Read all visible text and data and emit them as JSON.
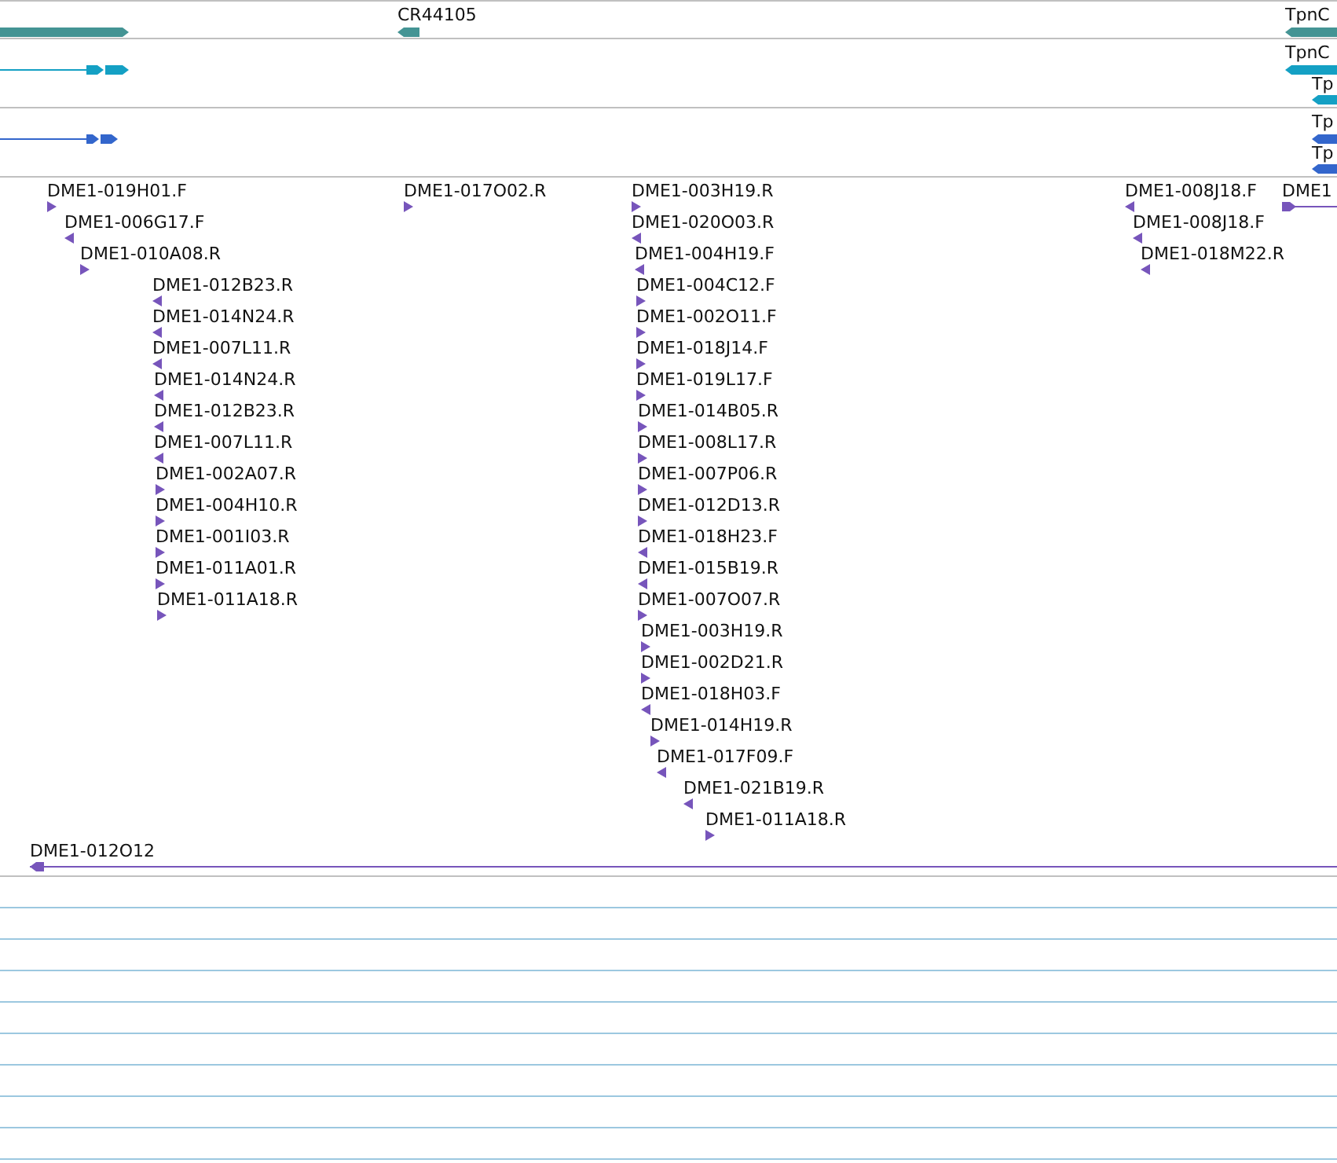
{
  "tracks": [
    {
      "kind": "genes",
      "features": [
        {
          "reverse": false
        },
        {
          "label": "CR44105",
          "reverse": true
        },
        {
          "label": "TpnC",
          "reverse": true
        }
      ]
    },
    {
      "kind": "transcripts",
      "features": [
        {
          "reverse": false
        },
        {
          "label": "TpnC",
          "reverse": true
        },
        {
          "label": "Tp",
          "reverse": true
        }
      ]
    },
    {
      "kind": "proteins",
      "features": [
        {
          "reverse": false
        },
        {
          "label": "Tp",
          "reverse": true
        },
        {
          "label": "Tp",
          "reverse": true
        }
      ]
    },
    {
      "kind": "reads",
      "features": [
        {
          "label": "DME1-019H01.F",
          "reverse": false
        },
        {
          "label": "DME1-006G17.F",
          "reverse": true
        },
        {
          "label": "DME1-010A08.R",
          "reverse": false
        },
        {
          "label": "DME1-012B23.R",
          "reverse": true
        },
        {
          "label": "DME1-014N24.R",
          "reverse": true
        },
        {
          "label": "DME1-007L11.R",
          "reverse": true
        },
        {
          "label": "DME1-014N24.R",
          "reverse": true
        },
        {
          "label": "DME1-012B23.R",
          "reverse": true
        },
        {
          "label": "DME1-007L11.R",
          "reverse": true
        },
        {
          "label": "DME1-002A07.R",
          "reverse": false
        },
        {
          "label": "DME1-004H10.R",
          "reverse": false
        },
        {
          "label": "DME1-001I03.R",
          "reverse": false
        },
        {
          "label": "DME1-011A01.R",
          "reverse": false
        },
        {
          "label": "DME1-011A18.R",
          "reverse": false
        },
        {
          "label": "DME1-017O02.R",
          "reverse": false
        },
        {
          "label": "DME1-003H19.R",
          "reverse": false
        },
        {
          "label": "DME1-020O03.R",
          "reverse": true
        },
        {
          "label": "DME1-004H19.F",
          "reverse": true
        },
        {
          "label": "DME1-004C12.F",
          "reverse": false
        },
        {
          "label": "DME1-002O11.F",
          "reverse": false
        },
        {
          "label": "DME1-018J14.F",
          "reverse": false
        },
        {
          "label": "DME1-019L17.F",
          "reverse": false
        },
        {
          "label": "DME1-014B05.R",
          "reverse": false
        },
        {
          "label": "DME1-008L17.R",
          "reverse": false
        },
        {
          "label": "DME1-007P06.R",
          "reverse": false
        },
        {
          "label": "DME1-012D13.R",
          "reverse": false
        },
        {
          "label": "DME1-018H23.F",
          "reverse": true
        },
        {
          "label": "DME1-015B19.R",
          "reverse": true
        },
        {
          "label": "DME1-007O07.R",
          "reverse": false
        },
        {
          "label": "DME1-003H19.R",
          "reverse": false
        },
        {
          "label": "DME1-002D21.R",
          "reverse": false
        },
        {
          "label": "DME1-018H03.F",
          "reverse": true
        },
        {
          "label": "DME1-014H19.R",
          "reverse": false
        },
        {
          "label": "DME1-017F09.F",
          "reverse": true
        },
        {
          "label": "DME1-021B19.R",
          "reverse": true
        },
        {
          "label": "DME1-011A18.R",
          "reverse": false
        },
        {
          "label": "DME1-008J18.F",
          "reverse": true
        },
        {
          "label": "DME1-008J18.F",
          "reverse": true
        },
        {
          "label": "DME1-018M22.R",
          "reverse": true
        },
        {
          "label": "DME1",
          "reverse": false
        },
        {
          "label": "DME1-012O12",
          "reverse": true
        }
      ]
    }
  ]
}
